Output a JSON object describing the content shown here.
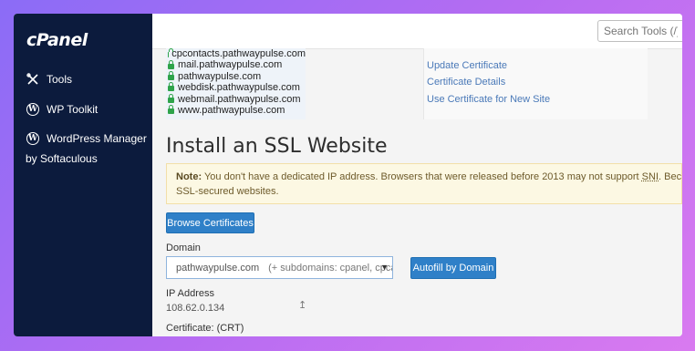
{
  "sidebar": {
    "logo": "cPanel",
    "items": [
      {
        "label": "Tools",
        "icon": "tools-icon"
      },
      {
        "label": "WP Toolkit",
        "icon": "wordpress-icon"
      },
      {
        "label": "WordPress Manager",
        "icon": "wordpress-icon"
      }
    ],
    "sub_label": "by Softaculous"
  },
  "topbar": {
    "search_placeholder": "Search Tools (/)"
  },
  "domains": [
    "cpcontacts.pathwaypulse.com",
    "mail.pathwaypulse.com",
    "pathwaypulse.com",
    "webdisk.pathwaypulse.com",
    "webmail.pathwaypulse.com",
    "www.pathwaypulse.com"
  ],
  "actions": [
    "Update Certificate",
    "Certificate Details",
    "Use Certificate for New Site"
  ],
  "install": {
    "title": "Install an SSL Website",
    "note_prefix": "Note:",
    "note_text_1": "You don't have a dedicated IP address. Browsers that were released before 2013 may not support",
    "note_sni": "SNI",
    "note_text_2": ". Because of this, users ma",
    "note_text_3": "SSL-secured websites.",
    "browse_button": "Browse Certificates",
    "domain_label": "Domain",
    "domain_value": "pathwaypulse.com",
    "domain_hint": "(+ subdomains: cpanel, cpcalen",
    "autofill_button": "Autofill by Domain",
    "ip_label": "IP Address",
    "ip_value": "108.62.0.134",
    "cert_label": "Certificate: (CRT)"
  },
  "colors": {
    "sidebar_bg": "#0c1b3d",
    "button_bg": "#2f80c8",
    "note_bg": "#fcf8e3",
    "lock": "#2ea34a"
  }
}
